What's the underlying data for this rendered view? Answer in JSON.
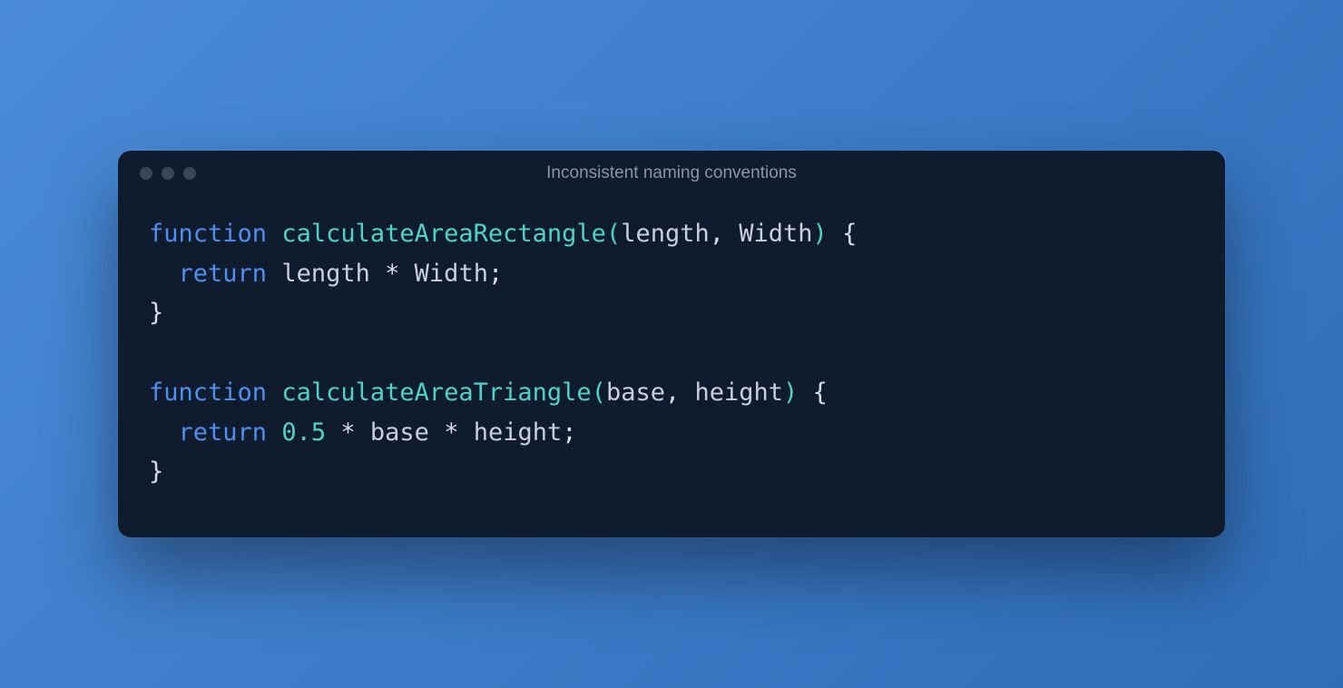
{
  "window": {
    "title": "Inconsistent naming conventions"
  },
  "code": {
    "lines": [
      [
        {
          "cls": "tk-keyword",
          "t": "function"
        },
        {
          "cls": "",
          "t": " "
        },
        {
          "cls": "tk-func",
          "t": "calculateAreaRectangle"
        },
        {
          "cls": "tk-paren",
          "t": "("
        },
        {
          "cls": "tk-param",
          "t": "length"
        },
        {
          "cls": "tk-punct",
          "t": ", "
        },
        {
          "cls": "tk-param",
          "t": "Width"
        },
        {
          "cls": "tk-paren",
          "t": ")"
        },
        {
          "cls": "",
          "t": " "
        },
        {
          "cls": "tk-brace",
          "t": "{"
        }
      ],
      [
        {
          "cls": "",
          "t": "  "
        },
        {
          "cls": "tk-return",
          "t": "return"
        },
        {
          "cls": "",
          "t": " "
        },
        {
          "cls": "tk-ident",
          "t": "length"
        },
        {
          "cls": "",
          "t": " "
        },
        {
          "cls": "tk-op",
          "t": "*"
        },
        {
          "cls": "",
          "t": " "
        },
        {
          "cls": "tk-ident",
          "t": "Width"
        },
        {
          "cls": "tk-punct",
          "t": ";"
        }
      ],
      [
        {
          "cls": "tk-brace",
          "t": "}"
        }
      ],
      [
        {
          "cls": "",
          "t": ""
        }
      ],
      [
        {
          "cls": "tk-keyword",
          "t": "function"
        },
        {
          "cls": "",
          "t": " "
        },
        {
          "cls": "tk-func",
          "t": "calculateAreaTriangle"
        },
        {
          "cls": "tk-paren",
          "t": "("
        },
        {
          "cls": "tk-param",
          "t": "base"
        },
        {
          "cls": "tk-punct",
          "t": ", "
        },
        {
          "cls": "tk-param",
          "t": "height"
        },
        {
          "cls": "tk-paren",
          "t": ")"
        },
        {
          "cls": "",
          "t": " "
        },
        {
          "cls": "tk-brace",
          "t": "{"
        }
      ],
      [
        {
          "cls": "",
          "t": "  "
        },
        {
          "cls": "tk-return",
          "t": "return"
        },
        {
          "cls": "",
          "t": " "
        },
        {
          "cls": "tk-number",
          "t": "0.5"
        },
        {
          "cls": "",
          "t": " "
        },
        {
          "cls": "tk-op",
          "t": "*"
        },
        {
          "cls": "",
          "t": " "
        },
        {
          "cls": "tk-ident",
          "t": "base"
        },
        {
          "cls": "",
          "t": " "
        },
        {
          "cls": "tk-op",
          "t": "*"
        },
        {
          "cls": "",
          "t": " "
        },
        {
          "cls": "tk-ident",
          "t": "height"
        },
        {
          "cls": "tk-punct",
          "t": ";"
        }
      ],
      [
        {
          "cls": "tk-brace",
          "t": "}"
        }
      ]
    ]
  }
}
